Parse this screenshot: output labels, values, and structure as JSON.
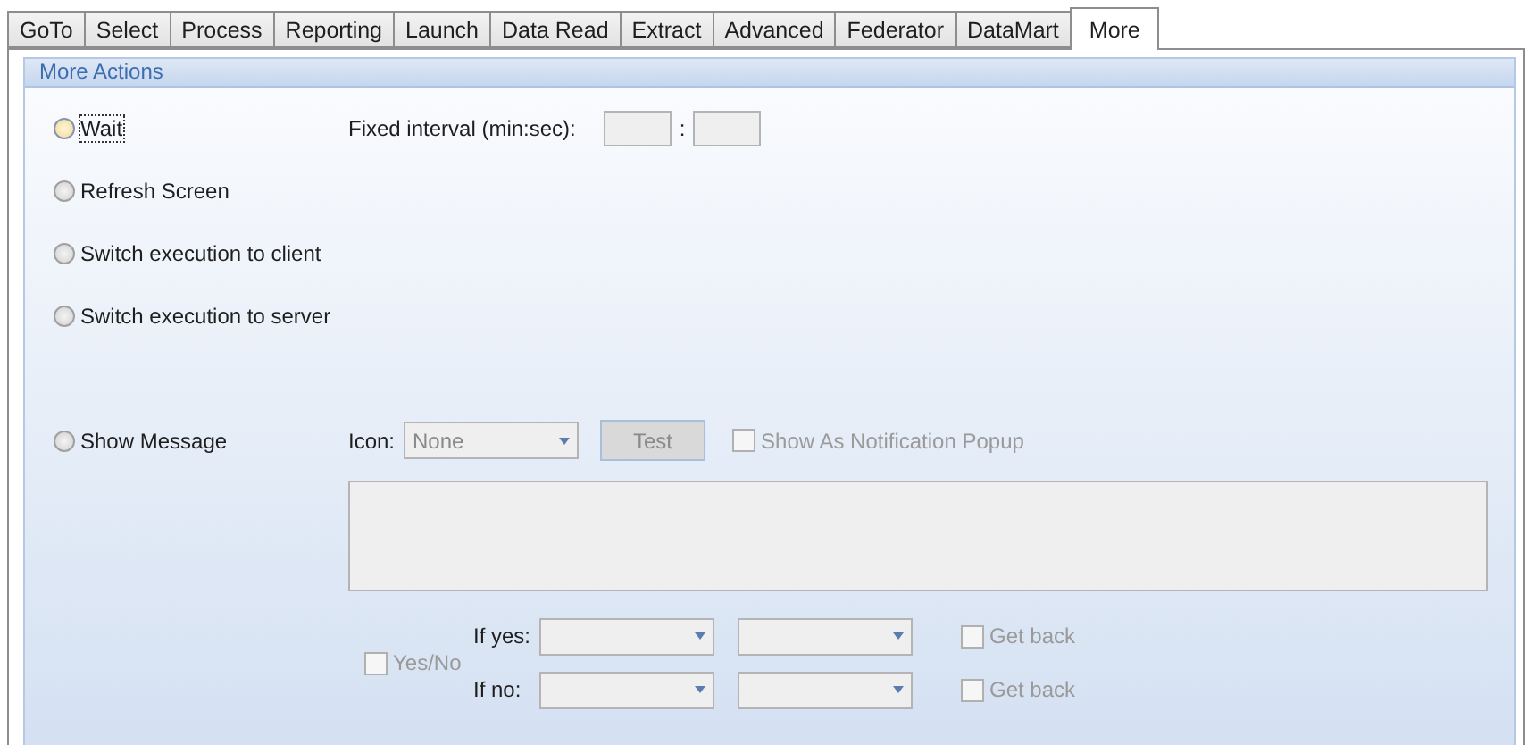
{
  "tabs": [
    {
      "label": "GoTo",
      "selected": false
    },
    {
      "label": "Select",
      "selected": false
    },
    {
      "label": "Process",
      "selected": false
    },
    {
      "label": "Reporting",
      "selected": false
    },
    {
      "label": "Launch",
      "selected": false
    },
    {
      "label": "Data Read",
      "selected": false
    },
    {
      "label": "Extract",
      "selected": false
    },
    {
      "label": "Advanced",
      "selected": false
    },
    {
      "label": "Federator",
      "selected": false
    },
    {
      "label": "DataMart",
      "selected": false
    },
    {
      "label": "More",
      "selected": true
    }
  ],
  "group": {
    "title": "More Actions"
  },
  "actions": [
    {
      "label": "Wait",
      "selected": false,
      "focused": true
    },
    {
      "label": "Refresh Screen",
      "selected": false,
      "focused": false
    },
    {
      "label": "Switch execution to client",
      "selected": false,
      "focused": false
    },
    {
      "label": "Switch execution to server",
      "selected": false,
      "focused": false
    },
    {
      "label": "Show Message",
      "selected": false,
      "focused": false
    }
  ],
  "interval": {
    "label": "Fixed interval (min:sec):",
    "separator": ":"
  },
  "message": {
    "icon_label": "Icon:",
    "icon_value": "None",
    "test_button": "Test",
    "notification": {
      "label": "Show As Notification Popup",
      "checked": false
    },
    "disabled": true
  },
  "yes_no": {
    "label": "Yes/No",
    "checked": false
  },
  "branches": [
    {
      "label": "If yes:",
      "get_back": {
        "label": "Get back",
        "checked": false
      }
    },
    {
      "label": "If no:",
      "get_back": {
        "label": "Get back",
        "checked": false
      }
    }
  ]
}
